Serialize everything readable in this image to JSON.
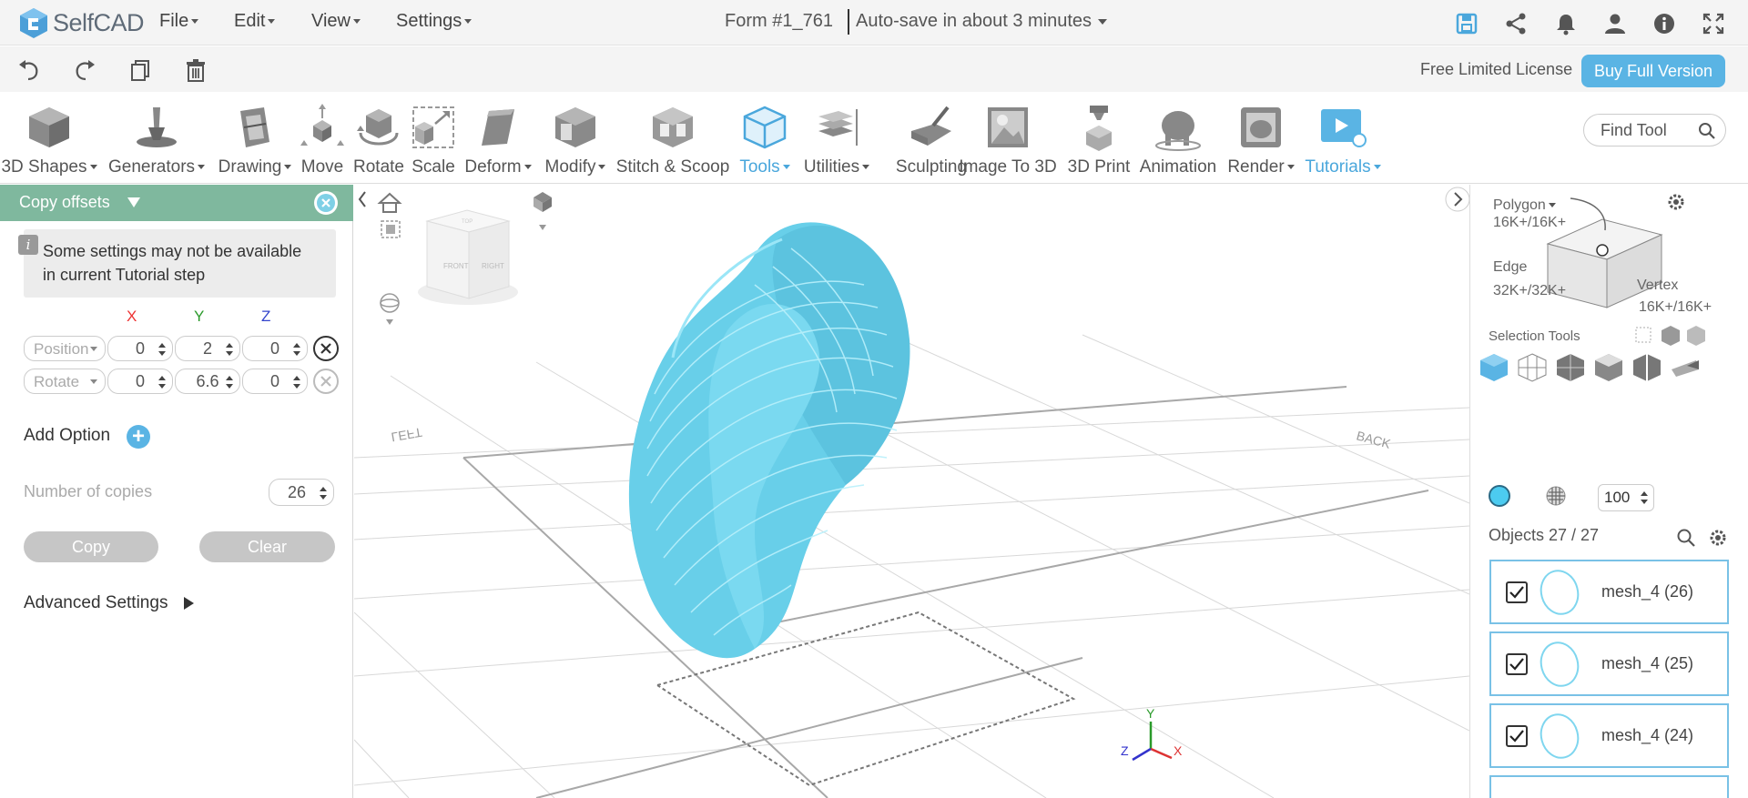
{
  "app": {
    "logo_text": "SelfCAD",
    "menus": [
      "File",
      "Edit",
      "View",
      "Settings"
    ],
    "doc_title": "Form #1_761",
    "autosave": "Auto-save in about 3 minutes"
  },
  "subbar": {
    "license": "Free Limited License",
    "buy_label": "Buy Full Version"
  },
  "toolbar": {
    "tools": [
      {
        "label": "3D Shapes",
        "icon": "cube-icon"
      },
      {
        "label": "Generators",
        "icon": "generator-icon"
      },
      {
        "label": "Drawing",
        "icon": "drawing-icon"
      },
      {
        "label": "Move",
        "icon": "move-icon"
      },
      {
        "label": "Rotate",
        "icon": "rotate-icon"
      },
      {
        "label": "Scale",
        "icon": "scale-icon"
      },
      {
        "label": "Deform",
        "icon": "deform-icon"
      },
      {
        "label": "Modify",
        "icon": "modify-icon"
      },
      {
        "label": "Stitch & Scoop",
        "icon": "stitch-scoop-icon"
      },
      {
        "label": "Tools",
        "icon": "tools-icon"
      },
      {
        "label": "Utilities",
        "icon": "utilities-icon"
      },
      {
        "label": "Sculpting",
        "icon": "sculpting-icon"
      },
      {
        "label": "Image To 3D",
        "icon": "image-to-3d-icon"
      },
      {
        "label": "3D Print",
        "icon": "3d-print-icon"
      },
      {
        "label": "Animation",
        "icon": "animation-icon"
      },
      {
        "label": "Render",
        "icon": "render-icon"
      },
      {
        "label": "Tutorials",
        "icon": "tutorials-icon"
      }
    ],
    "find_placeholder": "Find Tool"
  },
  "left_panel": {
    "title": "Copy offsets",
    "info": "Some settings may not be available in current Tutorial step",
    "axes": {
      "x": "X",
      "y": "Y",
      "z": "Z"
    },
    "position_label": "Position",
    "position": {
      "x": "0",
      "y": "2",
      "z": "0"
    },
    "rotate_label": "Rotate",
    "rotate": {
      "x": "0",
      "y": "6.6",
      "z": "0"
    },
    "add_option": "Add Option",
    "copies_label": "Number of copies",
    "copies_value": "26",
    "copy_btn": "Copy",
    "clear_btn": "Clear",
    "advanced": "Advanced Settings"
  },
  "viewport": {
    "view_cube": {
      "front": "FRONT",
      "right": "RIGHT",
      "top": "TOP"
    },
    "ground_left": "LEFT",
    "ground_back": "BACK",
    "axis_x": "X",
    "axis_y": "Y",
    "axis_z": "Z",
    "model_color": "#6fd4ee"
  },
  "right_panel": {
    "polygon_label": "Polygon",
    "polygon_count": "16K+/16K+",
    "edge_label": "Edge",
    "edge_count": "32K+/32K+",
    "vertex_label": "Vertex",
    "vertex_count": "16K+/16K+",
    "selection_tools": "Selection Tools",
    "opacity": "100",
    "objects_title": "Objects 27 / 27",
    "objects": [
      {
        "name": "mesh_4 (26)"
      },
      {
        "name": "mesh_4 (25)"
      },
      {
        "name": "mesh_4 (24)"
      }
    ]
  },
  "colors": {
    "accent": "#5ab4e4",
    "panel_header": "#7fb89e",
    "model": "#6fd4ee"
  }
}
